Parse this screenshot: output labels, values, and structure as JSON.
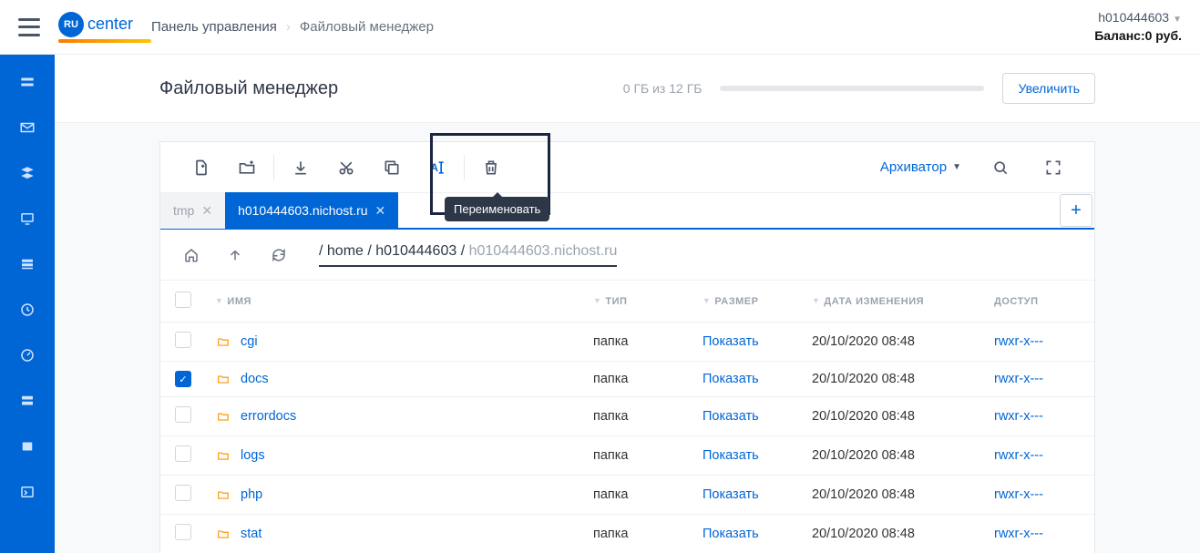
{
  "header": {
    "logo_badge": "RU",
    "logo_text": "center",
    "breadcrumb_panel": "Панель управления",
    "breadcrumb_current": "Файловый менеджер",
    "account": "h010444603",
    "balance_label": "Баланс:",
    "balance_value": "0 руб."
  },
  "title": {
    "heading": "Файловый менеджер",
    "quota": "0 ГБ из 12 ГБ",
    "increase_btn": "Увеличить"
  },
  "toolbar": {
    "rename_tooltip": "Переименовать",
    "archiver": "Архиватор"
  },
  "tabs": [
    {
      "label": "tmp",
      "active": false
    },
    {
      "label": "h010444603.nichost.ru",
      "active": true
    }
  ],
  "path": {
    "seg1": "home",
    "seg2": "h010444603",
    "seg3": "h010444603.nichost.ru"
  },
  "columns": {
    "name": "ИМЯ",
    "type": "ТИП",
    "size": "РАЗМЕР",
    "date": "ДАТА ИЗМЕНЕНИЯ",
    "perm": "ДОСТУП"
  },
  "rows": [
    {
      "checked": false,
      "name": "cgi",
      "type": "папка",
      "size": "Показать",
      "date": "20/10/2020 08:48",
      "perm": "rwxr-x---"
    },
    {
      "checked": true,
      "name": "docs",
      "type": "папка",
      "size": "Показать",
      "date": "20/10/2020 08:48",
      "perm": "rwxr-x---"
    },
    {
      "checked": false,
      "name": "errordocs",
      "type": "папка",
      "size": "Показать",
      "date": "20/10/2020 08:48",
      "perm": "rwxr-x---"
    },
    {
      "checked": false,
      "name": "logs",
      "type": "папка",
      "size": "Показать",
      "date": "20/10/2020 08:48",
      "perm": "rwxr-x---"
    },
    {
      "checked": false,
      "name": "php",
      "type": "папка",
      "size": "Показать",
      "date": "20/10/2020 08:48",
      "perm": "rwxr-x---"
    },
    {
      "checked": false,
      "name": "stat",
      "type": "папка",
      "size": "Показать",
      "date": "20/10/2020 08:48",
      "perm": "rwxr-x---"
    }
  ]
}
